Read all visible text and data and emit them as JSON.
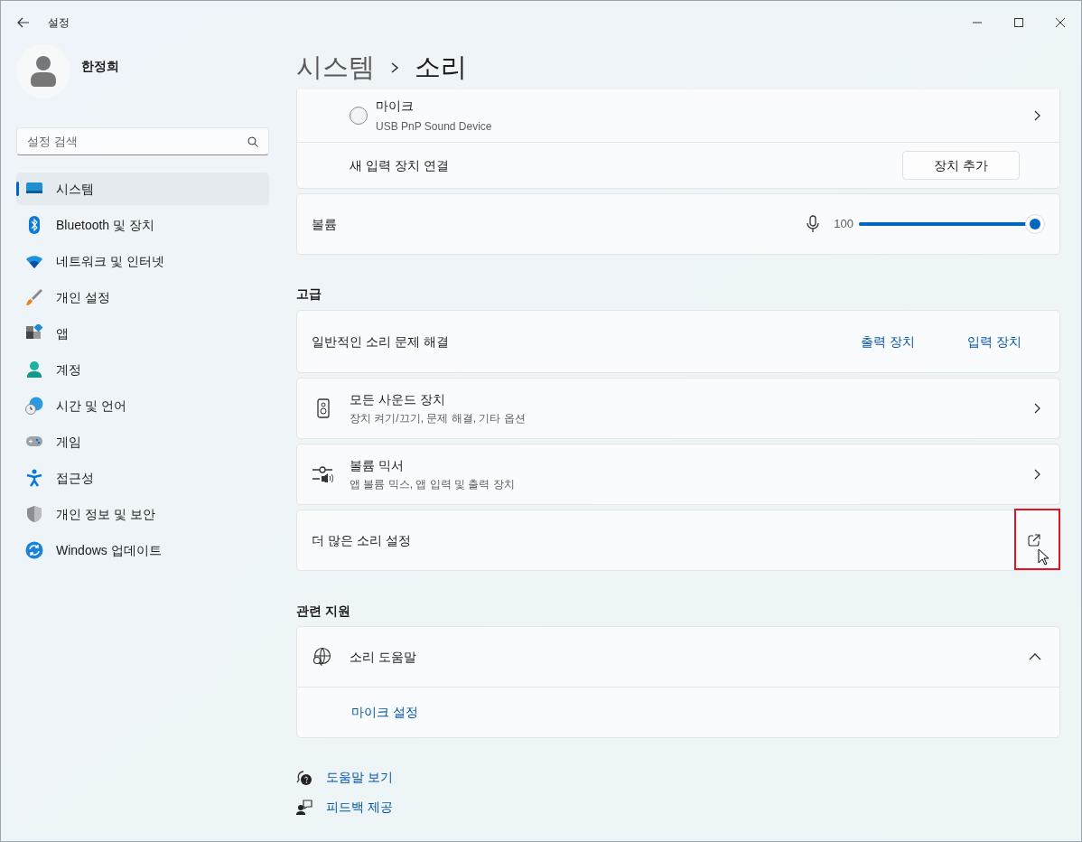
{
  "window": {
    "title": "설정"
  },
  "user": {
    "name": "한정희"
  },
  "search": {
    "placeholder": "설정 검색"
  },
  "sidebar": {
    "items": [
      {
        "label": "시스템",
        "selected": true
      },
      {
        "label": "Bluetooth 및 장치",
        "selected": false
      },
      {
        "label": "네트워크 및 인터넷",
        "selected": false
      },
      {
        "label": "개인 설정",
        "selected": false
      },
      {
        "label": "앱",
        "selected": false
      },
      {
        "label": "계정",
        "selected": false
      },
      {
        "label": "시간 및 언어",
        "selected": false
      },
      {
        "label": "게임",
        "selected": false
      },
      {
        "label": "접근성",
        "selected": false
      },
      {
        "label": "개인 정보 및 보안",
        "selected": false
      },
      {
        "label": "Windows 업데이트",
        "selected": false
      }
    ]
  },
  "breadcrumb": [
    "시스템",
    "소리"
  ],
  "input_device": {
    "name": "마이크",
    "detail": "USB PnP Sound Device",
    "selected": false
  },
  "connect": {
    "label": "새 입력 장치 연결",
    "button": "장치 추가"
  },
  "volume": {
    "label": "볼륨",
    "reading": "100",
    "level": 1.0
  },
  "advanced": {
    "heading": "고급",
    "troubleshoot": {
      "label": "일반적인 소리 문제 해결",
      "links": [
        "출력 장치",
        "입력 장치"
      ]
    },
    "rows": [
      {
        "kind": "chevron",
        "title": "모든 사운드 장치",
        "subtitle": "장치 켜기/끄기, 문제 해결, 기타 옵션"
      },
      {
        "kind": "chevron",
        "title": "볼륨 믹서",
        "subtitle": "앱 볼륨 믹스, 앱 입력 및 출력 장치"
      },
      {
        "kind": "external",
        "title": "더 많은 소리 설정",
        "highlighted": true
      }
    ]
  },
  "related": {
    "heading": "관련 지원",
    "help": {
      "title": "소리 도움말",
      "expanded": true,
      "links": [
        "마이크 설정"
      ]
    }
  },
  "footer_links": [
    "도움말 보기",
    "피드백 제공"
  ]
}
